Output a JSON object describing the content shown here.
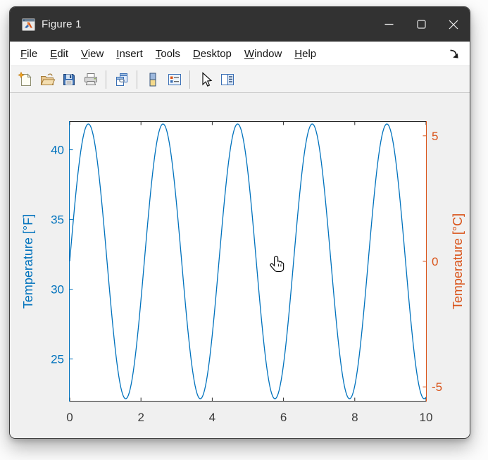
{
  "window": {
    "title": "Figure 1",
    "app_icon": "matlab-figure-icon",
    "controls": {
      "minimize": "minimize",
      "maximize": "maximize",
      "close": "close"
    }
  },
  "menu": {
    "items": [
      {
        "first": "F",
        "rest": "ile"
      },
      {
        "first": "E",
        "rest": "dit"
      },
      {
        "first": "V",
        "rest": "iew"
      },
      {
        "first": "I",
        "rest": "nsert"
      },
      {
        "first": "T",
        "rest": "ools"
      },
      {
        "first": "D",
        "rest": "esktop"
      },
      {
        "first": "W",
        "rest": "indow"
      },
      {
        "first": "H",
        "rest": "elp"
      }
    ],
    "dock_icon": "dock-arrow-icon"
  },
  "toolbar": {
    "buttons": [
      "new-figure",
      "open-file",
      "save-figure",
      "print-figure",
      "link-plot",
      "insert-colorbar",
      "insert-legend",
      "edit-plot",
      "open-property-inspector"
    ]
  },
  "cursor": {
    "shape": "hand-pointer-cursor"
  },
  "chart_data": {
    "type": "line",
    "title": "",
    "grid": false,
    "plot_background": "#ffffff",
    "x_axis": {
      "label": "",
      "lim": [
        0,
        10
      ],
      "ticks": [
        0,
        2,
        4,
        6,
        8,
        10
      ],
      "color": "#262626"
    },
    "left_axis": {
      "label": "Temperature [°F]",
      "color": "#0072BD",
      "lim": [
        22,
        42
      ],
      "ticks": [
        25,
        30,
        35,
        40
      ]
    },
    "right_axis": {
      "label": "Temperature [°C]",
      "color": "#D95319",
      "ticks": [
        -5,
        0,
        5
      ],
      "to_left_scale": 1.8,
      "to_left_offset": 32,
      "lim_celsius": [
        -5.56,
        5.56
      ]
    },
    "series": [
      {
        "name": "temperature",
        "color": "#0072BD",
        "line_width": 1.3,
        "model_fahrenheit": "32 + 9.85*sin(3*x)",
        "model_celsius": "5.47*sin(3*x)",
        "offset_f": 32,
        "amplitude_f": 9.85,
        "omega": 3,
        "samples": 480
      }
    ]
  }
}
